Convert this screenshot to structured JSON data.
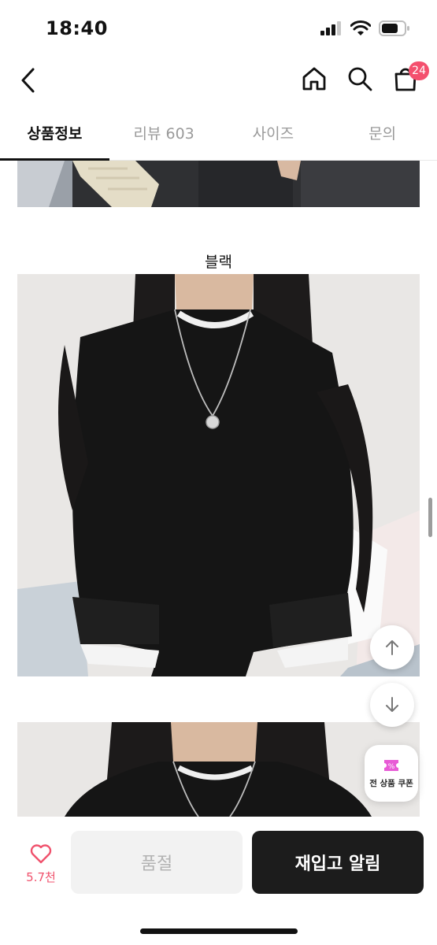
{
  "status": {
    "time": "18:40"
  },
  "header": {
    "cart_count": "24"
  },
  "tabs": [
    {
      "label": "상품정보"
    },
    {
      "label": "리뷰 603"
    },
    {
      "label": "사이즈"
    },
    {
      "label": "문의"
    }
  ],
  "content": {
    "color_caption": "블랙"
  },
  "floating": {
    "coupon_label": "전 상품 쿠폰"
  },
  "bottom": {
    "like_count": "5.7천",
    "soldout_label": "품절",
    "restock_label": "재입고 알림"
  },
  "colors": {
    "accent": "#f4506e",
    "dark_button": "#1c1c1c"
  }
}
